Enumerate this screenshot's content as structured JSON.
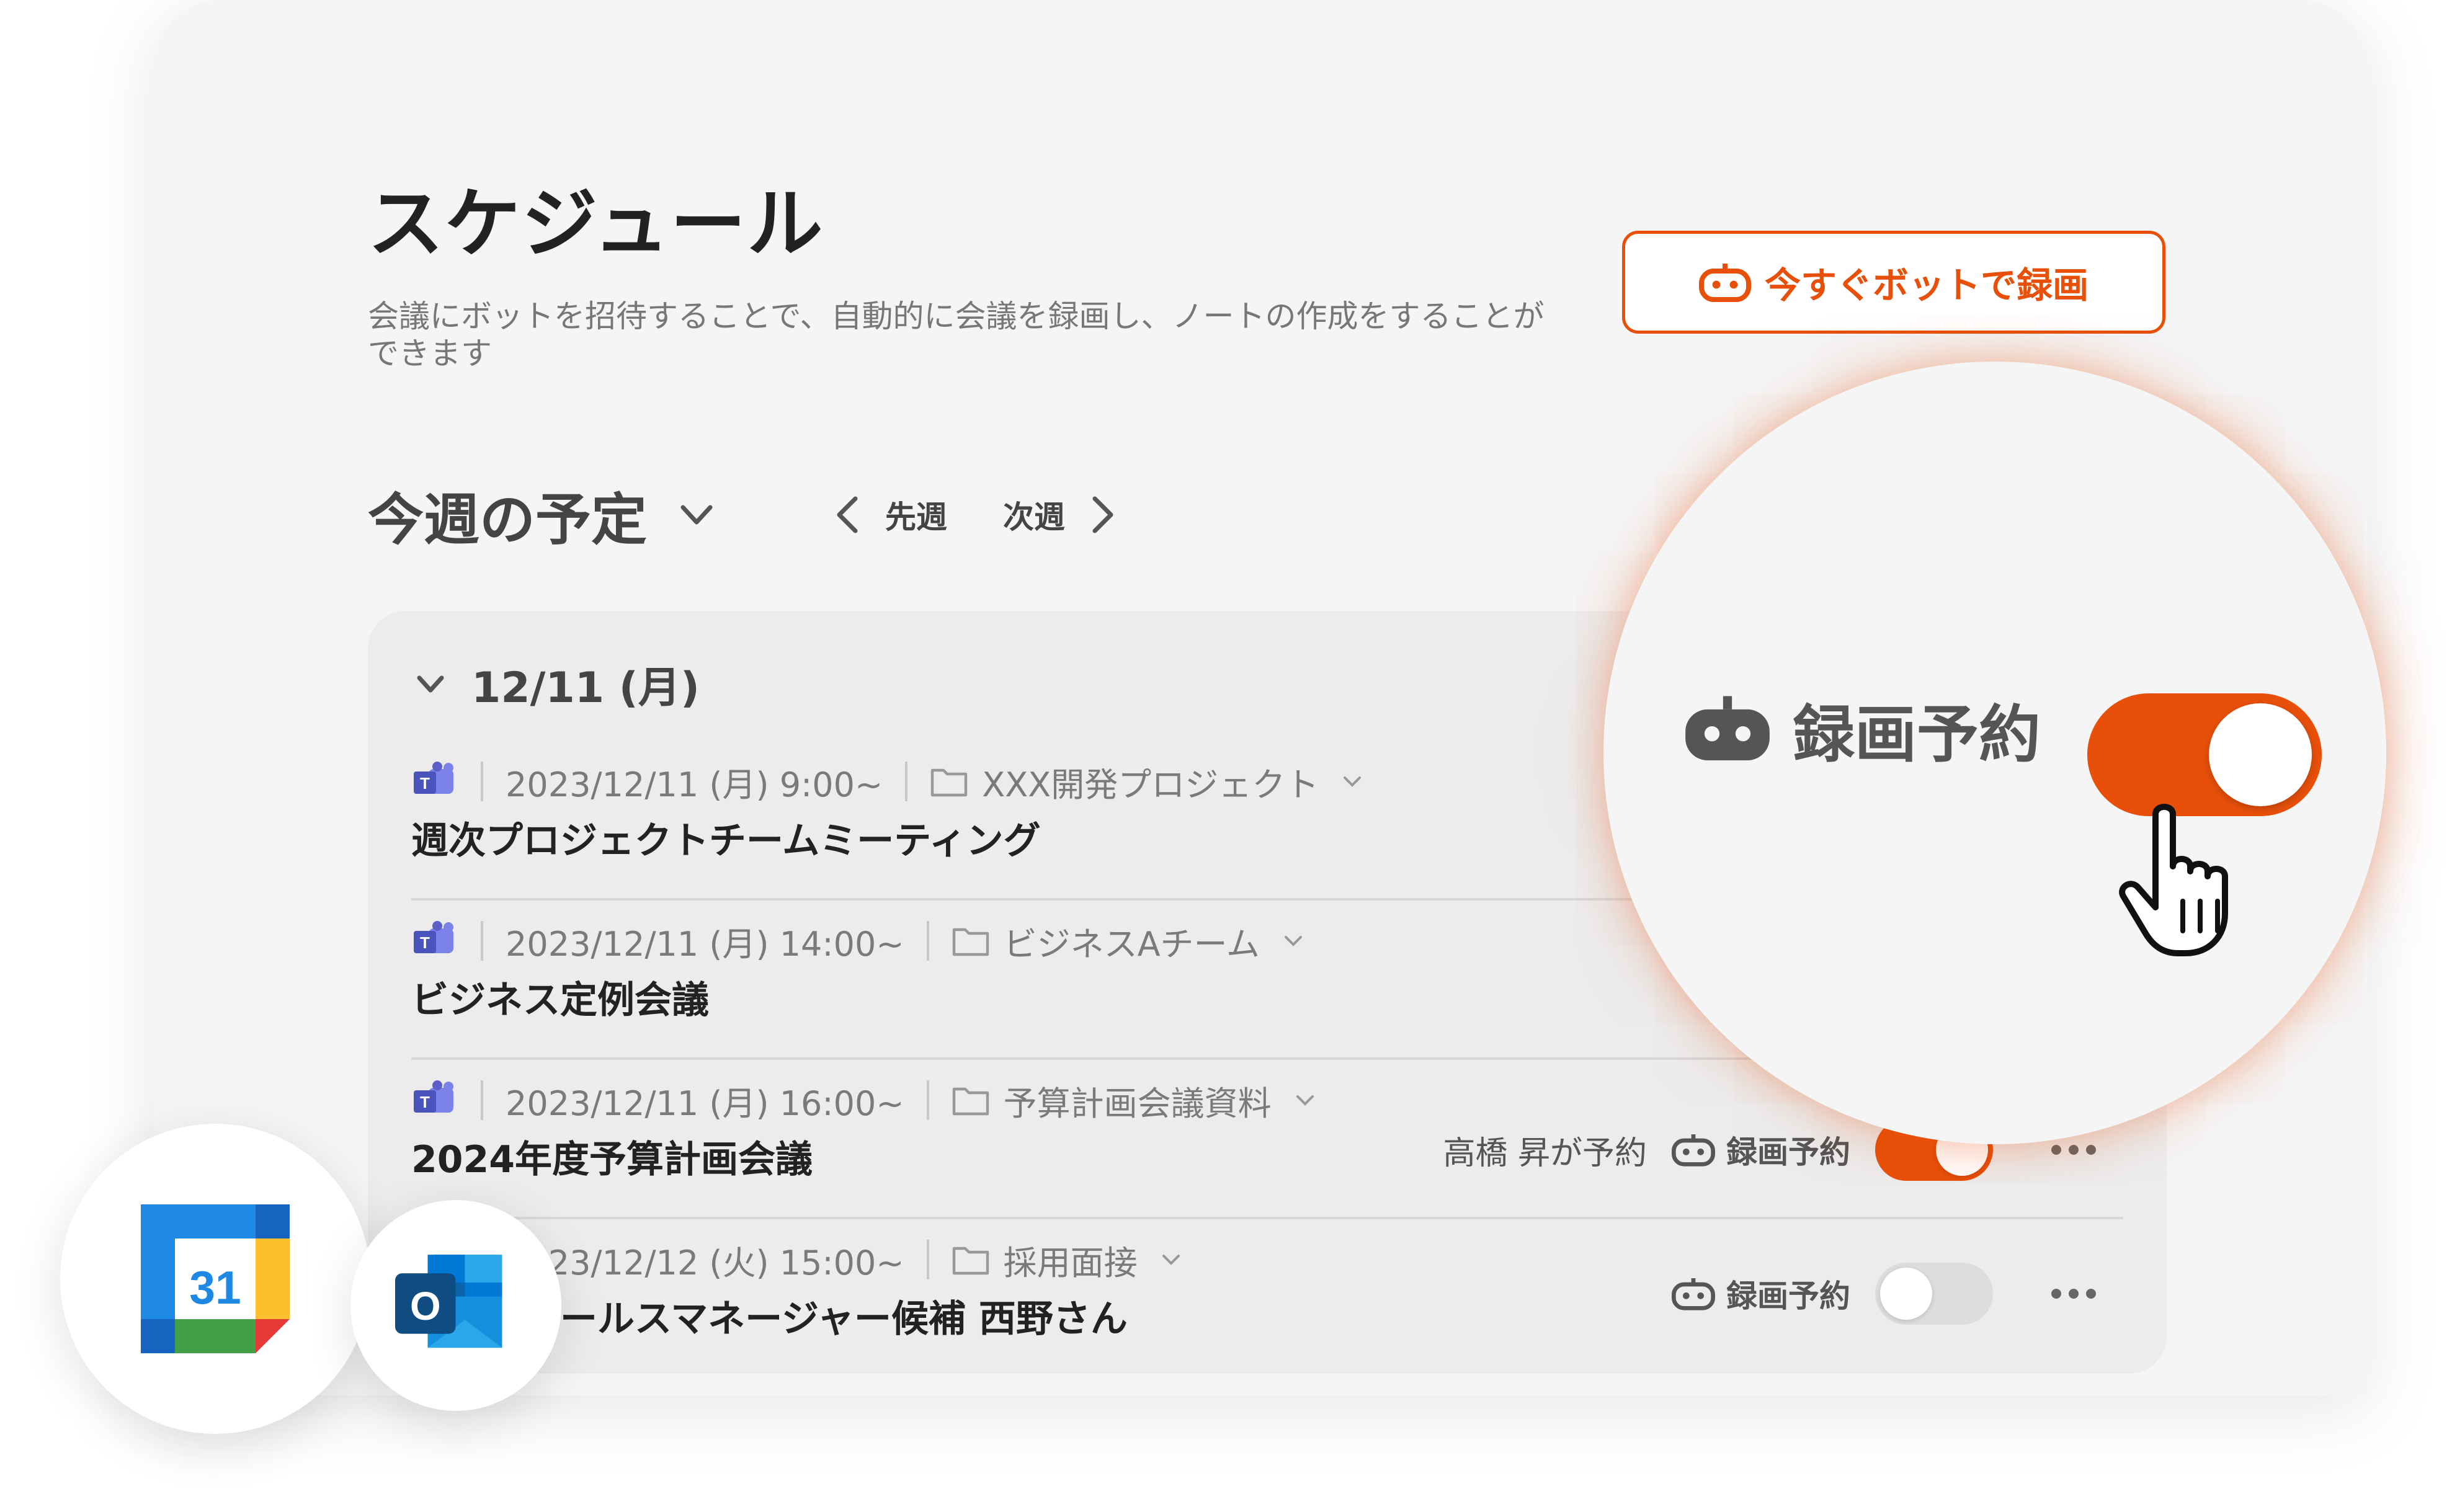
{
  "header": {
    "title": "スケジュール",
    "description": "会議にボットを招待することで、自動的に会議を録画し、ノートの作成をすることができます",
    "record_now_label": "今すぐボットで録画"
  },
  "week_nav": {
    "title": "今週の予定",
    "prev_label": "先週",
    "next_label": "次週"
  },
  "day": {
    "label": "12/11 (月)"
  },
  "meetings": [
    {
      "datetime": "2023/12/11 (月) 9:00~",
      "folder": "XXX開発プロジェクト",
      "title": "週次プロジェクトチームミーティング"
    },
    {
      "datetime": "2023/12/11 (月) 14:00~",
      "folder": "ビジネスAチーム",
      "title": "ビジネス定例会議"
    },
    {
      "datetime": "2023/12/11 (月) 16:00~",
      "folder": "予算計画会議資料",
      "title": "2024年度予算計画会議",
      "reserved_by": "高橋 昇が予約",
      "record_label": "録画予約"
    },
    {
      "datetime": "2023/12/12 (火) 15:00~",
      "folder": "採用面接",
      "title": "面接：セールスマネージャー候補 西野さん",
      "record_label": "録画予約"
    }
  ],
  "magnifier": {
    "label": "録画予約"
  },
  "apps": {
    "calendar_day": "31",
    "outlook_letter": "O"
  },
  "colors": {
    "accent": "#e8500a",
    "teams": "#5b5fc7"
  }
}
